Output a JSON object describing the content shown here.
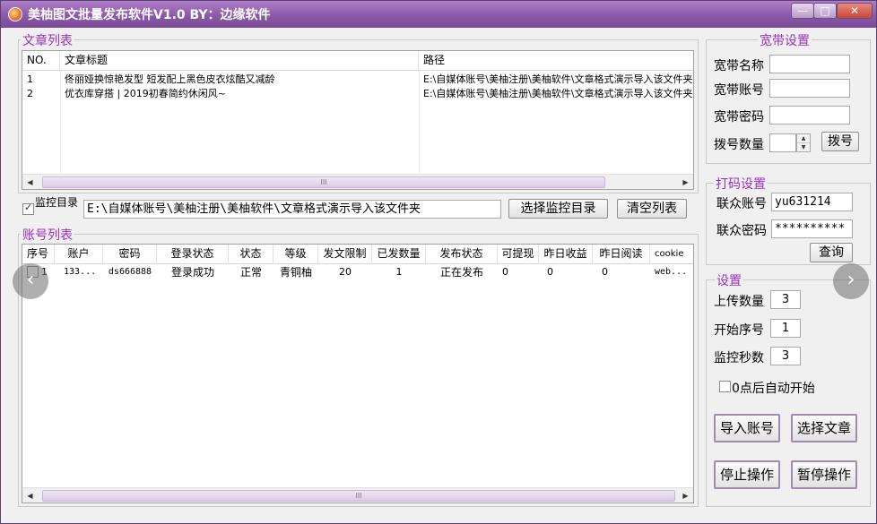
{
  "window": {
    "title": "美柚图文批量发布软件V1.0 BY：边缘软件",
    "min_glyph": "—",
    "max_glyph": "□",
    "close_glyph": "✕"
  },
  "articles": {
    "group_title": "文章列表",
    "columns": [
      "NO.",
      "文章标题",
      "路径"
    ],
    "rows": [
      {
        "no": "1",
        "title": "佟丽娅换惊艳发型 短发配上黑色皮衣炫酷又减龄",
        "path": "E:\\自媒体账号\\美柚注册\\美柚软件\\文章格式演示导入该文件夹"
      },
      {
        "no": "2",
        "title": "优衣库穿搭 | 2019初春简约休闲风~",
        "path": "E:\\自媒体账号\\美柚注册\\美柚软件\\文章格式演示导入该文件夹"
      }
    ],
    "scroll_thumb": "III"
  },
  "monitor": {
    "checkbox_label": "监控目录",
    "checked": true,
    "path_value": "E:\\自媒体账号\\美柚注册\\美柚软件\\文章格式演示导入该文件夹",
    "select_button": "选择监控目录",
    "clear_button": "清空列表"
  },
  "accounts": {
    "group_title": "账号列表",
    "columns": [
      "序号",
      "账户",
      "密码",
      "登录状态",
      "状态",
      "等级",
      "发文限制",
      "已发数量",
      "发布状态",
      "可提现",
      "昨日收益",
      "昨日阅读",
      "cookie"
    ],
    "rows": [
      {
        "no": "1",
        "account": "133...",
        "password": "ds666888",
        "login_status": "登录成功",
        "status": "正常",
        "level": "青铜柚",
        "limit": "20",
        "sent": "1",
        "publish_status": "正在发布",
        "withdrawable": "0",
        "yesterday_income": "0",
        "yesterday_reads": "0",
        "cookie": "web..."
      }
    ],
    "scroll_thumb": "III"
  },
  "broadband": {
    "group_title": "宽带设置",
    "name_label": "宽带名称",
    "name_value": "",
    "account_label": "宽带账号",
    "account_value": "",
    "password_label": "宽带密码",
    "password_value": "",
    "dial_count_label": "拨号数量",
    "dial_count_value": "",
    "dial_button": "拨号"
  },
  "captcha": {
    "group_title": "打码设置",
    "account_label": "联众账号",
    "account_value": "yu631214",
    "password_label": "联众密码",
    "password_value": "**********",
    "query_button": "查询"
  },
  "settings": {
    "group_title": "设置",
    "upload_label": "上传数量",
    "upload_value": "3",
    "start_label": "开始序号",
    "start_value": "1",
    "interval_label": "监控秒数",
    "interval_value": "3",
    "auto_start_label": "0点后自动开始",
    "auto_start_checked": false
  },
  "actions": {
    "import_accounts": "导入账号",
    "select_articles": "选择文章",
    "stop": "停止操作",
    "pause": "暂停操作"
  },
  "overlay": {
    "prev_glyph": "‹",
    "next_glyph": "›"
  },
  "colors": {
    "accent": "#9b2fc2",
    "titlebar": "#8a5aa8"
  }
}
